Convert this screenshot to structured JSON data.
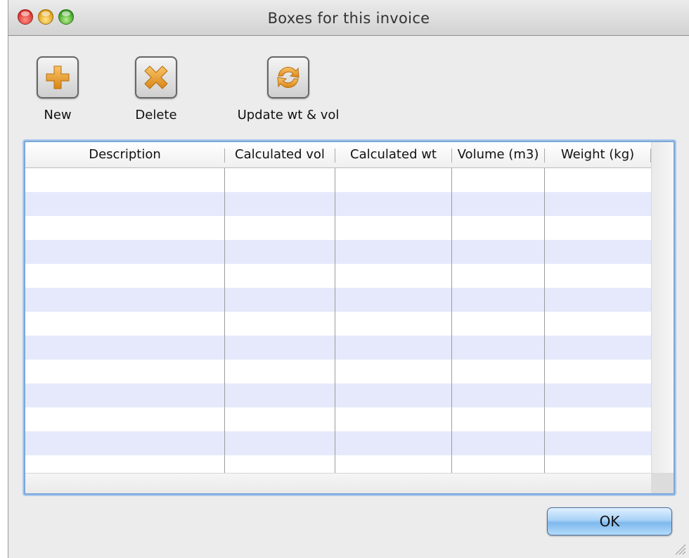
{
  "window": {
    "title": "Boxes for this invoice"
  },
  "toolbar": {
    "new_label": "New",
    "delete_label": "Delete",
    "update_label": "Update wt & vol"
  },
  "table": {
    "columns": [
      "Description",
      "Calculated vol",
      "Calculated wt",
      "Volume (m3)",
      "Weight (kg)"
    ],
    "rows": []
  },
  "footer": {
    "ok_label": "OK"
  },
  "colors": {
    "row_alt": "#e5e9fb",
    "focus_ring": "#7aa7d9",
    "icon_orange": "#e89a2c"
  },
  "icons": {
    "new": "plus-icon",
    "delete": "x-icon",
    "update": "refresh-icon"
  }
}
